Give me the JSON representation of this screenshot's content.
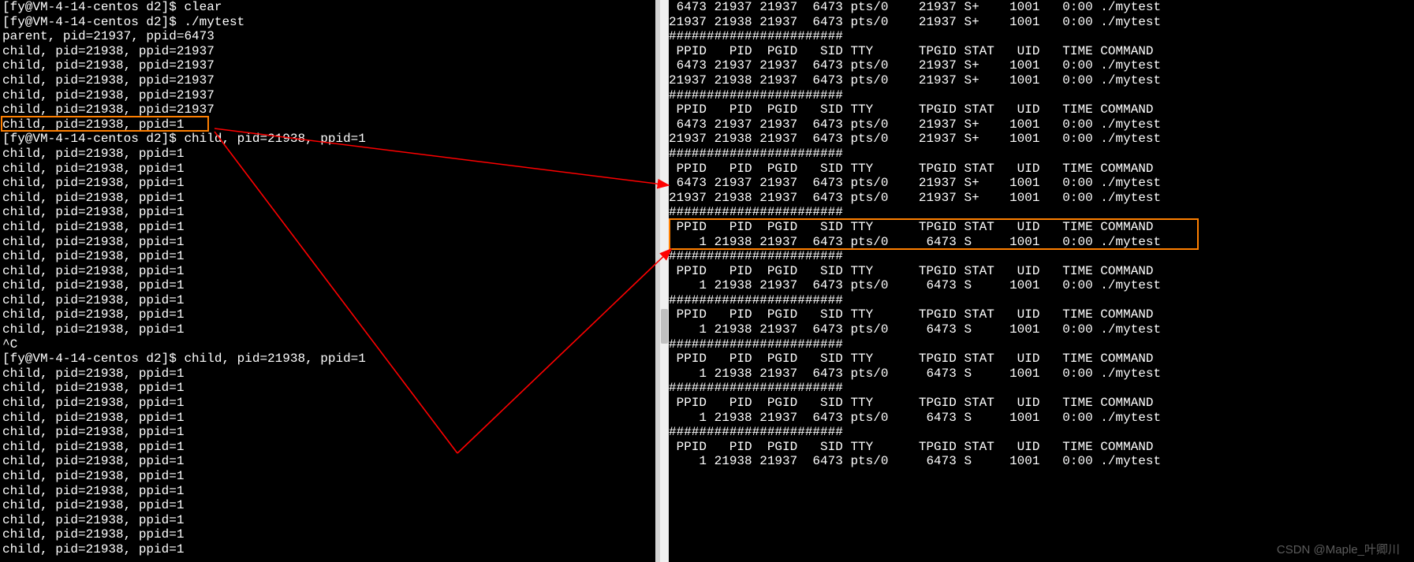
{
  "left": {
    "lines": [
      "[fy@VM-4-14-centos d2]$ clear",
      "[fy@VM-4-14-centos d2]$ ./mytest",
      "parent, pid=21937, ppid=6473",
      "child, pid=21938, ppid=21937",
      "child, pid=21938, ppid=21937",
      "child, pid=21938, ppid=21937",
      "child, pid=21938, ppid=21937",
      "child, pid=21938, ppid=21937",
      "child, pid=21938, ppid=1",
      "[fy@VM-4-14-centos d2]$ child, pid=21938, ppid=1",
      "child, pid=21938, ppid=1",
      "child, pid=21938, ppid=1",
      "child, pid=21938, ppid=1",
      "child, pid=21938, ppid=1",
      "child, pid=21938, ppid=1",
      "child, pid=21938, ppid=1",
      "child, pid=21938, ppid=1",
      "child, pid=21938, ppid=1",
      "child, pid=21938, ppid=1",
      "child, pid=21938, ppid=1",
      "child, pid=21938, ppid=1",
      "child, pid=21938, ppid=1",
      "child, pid=21938, ppid=1",
      "^C",
      "[fy@VM-4-14-centos d2]$ child, pid=21938, ppid=1",
      "child, pid=21938, ppid=1",
      "child, pid=21938, ppid=1",
      "child, pid=21938, ppid=1",
      "child, pid=21938, ppid=1",
      "child, pid=21938, ppid=1",
      "child, pid=21938, ppid=1",
      "child, pid=21938, ppid=1",
      "child, pid=21938, ppid=1",
      "child, pid=21938, ppid=1",
      "child, pid=21938, ppid=1",
      "child, pid=21938, ppid=1",
      "child, pid=21938, ppid=1",
      "child, pid=21938, ppid=1"
    ],
    "highlighted_line_index": 8
  },
  "right": {
    "lines": [
      " 6473 21937 21937  6473 pts/0    21937 S+    1001   0:00 ./mytest",
      "21937 21938 21937  6473 pts/0    21937 S+    1001   0:00 ./mytest",
      "#######################",
      " PPID   PID  PGID   SID TTY      TPGID STAT   UID   TIME COMMAND",
      " 6473 21937 21937  6473 pts/0    21937 S+    1001   0:00 ./mytest",
      "21937 21938 21937  6473 pts/0    21937 S+    1001   0:00 ./mytest",
      "#######################",
      " PPID   PID  PGID   SID TTY      TPGID STAT   UID   TIME COMMAND",
      " 6473 21937 21937  6473 pts/0    21937 S+    1001   0:00 ./mytest",
      "21937 21938 21937  6473 pts/0    21937 S+    1001   0:00 ./mytest",
      "#######################",
      " PPID   PID  PGID   SID TTY      TPGID STAT   UID   TIME COMMAND",
      " 6473 21937 21937  6473 pts/0    21937 S+    1001   0:00 ./mytest",
      "21937 21938 21937  6473 pts/0    21937 S+    1001   0:00 ./mytest",
      "#######################",
      " PPID   PID  PGID   SID TTY      TPGID STAT   UID   TIME COMMAND",
      "    1 21938 21937  6473 pts/0     6473 S     1001   0:00 ./mytest",
      "#######################",
      " PPID   PID  PGID   SID TTY      TPGID STAT   UID   TIME COMMAND",
      "    1 21938 21937  6473 pts/0     6473 S     1001   0:00 ./mytest",
      "#######################",
      " PPID   PID  PGID   SID TTY      TPGID STAT   UID   TIME COMMAND",
      "    1 21938 21937  6473 pts/0     6473 S     1001   0:00 ./mytest",
      "#######################",
      " PPID   PID  PGID   SID TTY      TPGID STAT   UID   TIME COMMAND",
      "    1 21938 21937  6473 pts/0     6473 S     1001   0:00 ./mytest",
      "#######################",
      " PPID   PID  PGID   SID TTY      TPGID STAT   UID   TIME COMMAND",
      "    1 21938 21937  6473 pts/0     6473 S     1001   0:00 ./mytest",
      "#######################",
      " PPID   PID  PGID   SID TTY      TPGID STAT   UID   TIME COMMAND",
      "    1 21938 21937  6473 pts/0     6473 S     1001   0:00 ./mytest"
    ],
    "highlighted_start": 15,
    "highlighted_end": 16
  },
  "watermark": "CSDN @Maple_叶卿川"
}
